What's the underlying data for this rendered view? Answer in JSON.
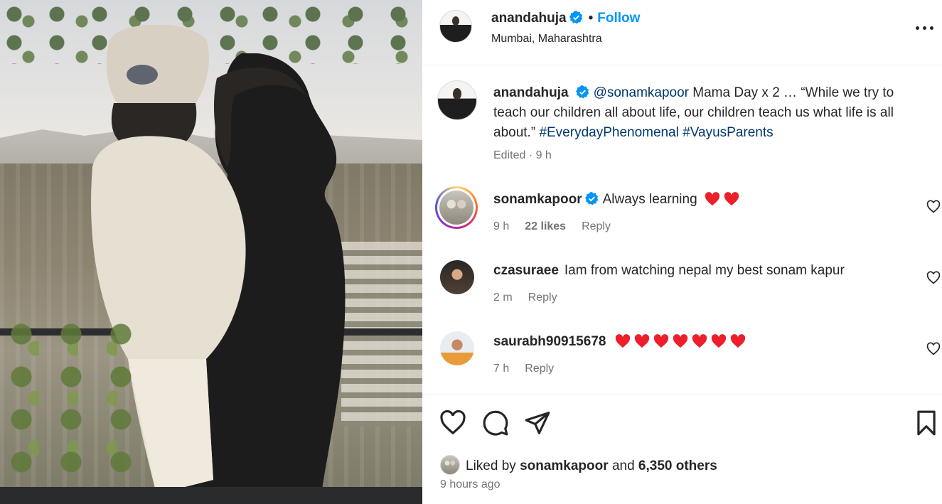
{
  "post": {
    "author": "anandahuja",
    "follow_label": "Follow",
    "separator": "•",
    "location": "Mumbai, Maharashtra",
    "caption": {
      "author": "anandahuja",
      "mention": "@sonamkapoor",
      "text": " Mama Day x 2 … “While we try to teach our children all about life, our children teach us what life is all about.” ",
      "hashtag_1": "#EverydayPhenomenal",
      "hashtag_2": "#VayusParents",
      "meta": "Edited · 9 h"
    },
    "comments": [
      {
        "user": "sonamkapoor",
        "verified": true,
        "text": "Always learning",
        "hearts": 2,
        "time": "9 h",
        "likes": "22 likes",
        "reply": "Reply"
      },
      {
        "user": "czasuraee",
        "verified": false,
        "text": "Iam from watching nepal my best sonam kapur",
        "hearts": 0,
        "time": "2 m",
        "likes": "",
        "reply": "Reply"
      },
      {
        "user": "saurabh90915678",
        "verified": false,
        "text": "",
        "hearts": 7,
        "time": "7 h",
        "likes": "",
        "reply": "Reply"
      }
    ],
    "liked_by": {
      "prefix": "Liked by",
      "user": "sonamkapoor",
      "middle": "and",
      "others": "6,350 others"
    },
    "posted": "9 hours ago"
  },
  "icons": {
    "verified": "verified-badge-icon",
    "more": "more-options-icon",
    "like": "heart-outline-icon",
    "comment": "comment-bubble-icon",
    "share": "paper-plane-icon",
    "save": "bookmark-icon",
    "red_heart": "red-heart-emoji"
  },
  "colors": {
    "link": "#0095f6",
    "hashtag": "#00376b",
    "secondary": "#737373",
    "verified": "#0095f6",
    "heart": "#ed1f2b"
  }
}
